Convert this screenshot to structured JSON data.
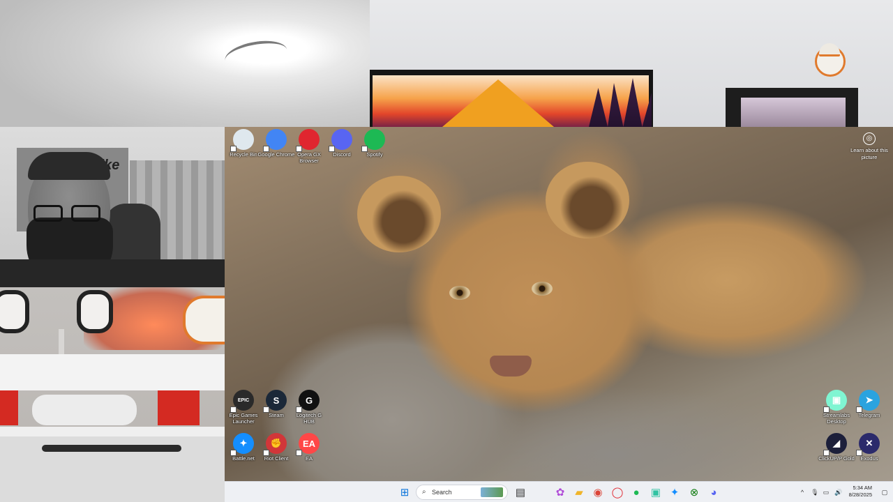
{
  "desktop": {
    "top_icons": [
      {
        "label": "Recycle Bin",
        "icon": "recycle-bin-icon",
        "color": "#dfe8ee"
      },
      {
        "label": "Google Chrome",
        "icon": "chrome-icon",
        "color": "#4285f4"
      },
      {
        "label": "Opera GX Browser",
        "icon": "opera-gx-icon",
        "color": "#e0262f"
      },
      {
        "label": "Discord",
        "icon": "discord-icon",
        "color": "#5865f2"
      },
      {
        "label": "Spotify",
        "icon": "spotify-icon",
        "color": "#1db954"
      }
    ],
    "bottom_left_icons": [
      {
        "label": "Epic Games Launcher",
        "icon": "epic-games-icon",
        "color": "#2a2a2a",
        "glyph": "EPIC"
      },
      {
        "label": "Steam",
        "icon": "steam-icon",
        "color": "#1b2838",
        "glyph": "S"
      },
      {
        "label": "Logitech G HUB",
        "icon": "logitech-g-hub-icon",
        "color": "#111111",
        "glyph": "G"
      },
      {
        "label": "Battle.net",
        "icon": "battlenet-icon",
        "color": "#148eff",
        "glyph": "✦"
      },
      {
        "label": "Riot Client",
        "icon": "riot-client-icon",
        "color": "#d13639",
        "glyph": "✊"
      },
      {
        "label": "EA",
        "icon": "ea-icon",
        "color": "#ff4747",
        "glyph": "EA"
      }
    ],
    "bottom_right_icons": [
      {
        "label": "Streamlabs Desktop",
        "icon": "streamlabs-icon",
        "color": "#80f5d2",
        "glyph": "▣"
      },
      {
        "label": "Telegram",
        "icon": "telegram-icon",
        "color": "#2aa3df",
        "glyph": "➤"
      },
      {
        "label": "ClickUP/P Gold",
        "icon": "clickup-icon",
        "color": "#1c1f3a",
        "glyph": "◢"
      },
      {
        "label": "Exodus",
        "icon": "exodus-icon",
        "color": "#2b2a6b",
        "glyph": "✕"
      }
    ],
    "learn_about": {
      "label": "Learn about this picture",
      "icon": "camera-icon"
    }
  },
  "taskbar": {
    "search_placeholder": "Search",
    "clock_time": "5:34 AM",
    "clock_date": "8/28/2025",
    "apps": [
      {
        "name": "windows-start-icon",
        "glyph": "⊞",
        "color": "#0a74da"
      },
      {
        "name": "task-view-icon",
        "glyph": "▤",
        "color": "#333333"
      },
      {
        "name": "copilot-icon",
        "glyph": "✿",
        "color": "#b04cd8"
      },
      {
        "name": "file-explorer-icon",
        "glyph": "▰",
        "color": "#f0b429"
      },
      {
        "name": "chrome-taskbar-icon",
        "glyph": "◉",
        "color": "#db4437"
      },
      {
        "name": "opera-taskbar-icon",
        "glyph": "◯",
        "color": "#e0262f"
      },
      {
        "name": "spotify-taskbar-icon",
        "glyph": "●",
        "color": "#1db954"
      },
      {
        "name": "streamlabs-taskbar-icon",
        "glyph": "▣",
        "color": "#31c3a2"
      },
      {
        "name": "battlenet-taskbar-icon",
        "glyph": "✦",
        "color": "#148eff"
      },
      {
        "name": "xbox-icon",
        "glyph": "⊗",
        "color": "#107c10"
      },
      {
        "name": "discord-taskbar-icon",
        "glyph": "◕",
        "color": "#5865f2"
      }
    ],
    "tray": [
      {
        "name": "chevron-up-icon",
        "glyph": "^"
      },
      {
        "name": "microphone-icon",
        "glyph": "🎙"
      },
      {
        "name": "network-icon",
        "glyph": "▭"
      },
      {
        "name": "volume-icon",
        "glyph": "🔊"
      }
    ]
  }
}
